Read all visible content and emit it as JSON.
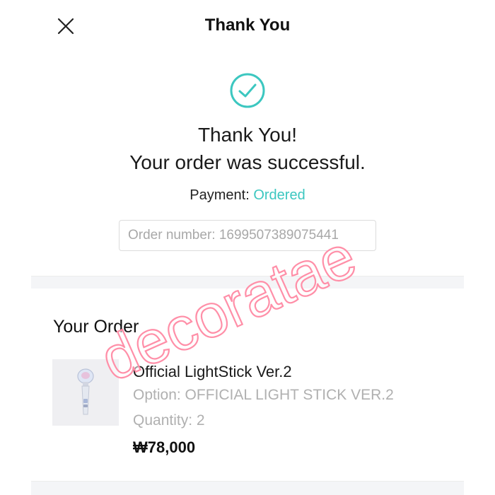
{
  "header": {
    "title": "Thank You",
    "close_icon": "close-icon"
  },
  "confirmation": {
    "icon": "check-circle-icon",
    "line1": "Thank You!",
    "line2": "Your order was successful.",
    "payment_label": "Payment:",
    "payment_status": "Ordered",
    "order_number": "Order number: 16995073890754​41"
  },
  "order": {
    "section_title": "Your Order",
    "items": [
      {
        "name": "Official LightStick Ver.2",
        "option": "Option: OFFICIAL LIGHT STICK VER.2",
        "quantity": "Quantity: 2",
        "price": "₩78,000",
        "thumbnail_icon": "lightstick-image"
      }
    ]
  },
  "watermark": {
    "text": "decoratae"
  },
  "colors": {
    "accent": "#3cc7c0",
    "muted_text": "#b0b0b0",
    "watermark": "#ff8fa8"
  }
}
